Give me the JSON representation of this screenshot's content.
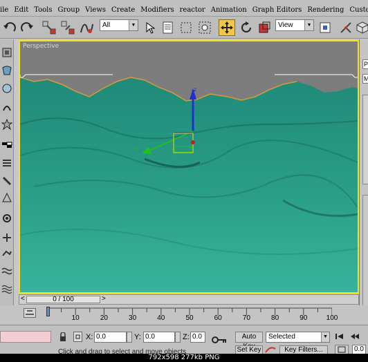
{
  "menu": [
    "ile",
    "Edit",
    "Tools",
    "Group",
    "Views",
    "Create",
    "Modifiers",
    "reactor",
    "Animation",
    "Graph Editors",
    "Rendering",
    "Customiz"
  ],
  "toolbar": {
    "selection_filter": "All",
    "ref_coord_system": "View"
  },
  "viewport": {
    "label": "Perspective",
    "gizmo_axes": [
      "z",
      "y"
    ]
  },
  "right_panel": {
    "boxes": [
      "P",
      "M"
    ]
  },
  "time_slider": {
    "value": "0 / 100",
    "prev": "<",
    "next": ">"
  },
  "trackbar": {
    "ticks": [
      "10",
      "20",
      "30",
      "40",
      "50",
      "60",
      "70",
      "80",
      "90",
      "100"
    ]
  },
  "status": {
    "x_label": "X:",
    "y_label": "Y:",
    "z_label": "Z:",
    "x_value": "0.0",
    "y_value": "0.0",
    "z_value": "0.0",
    "auto_key": "Auto Key",
    "set_key": "Set Key",
    "key_filters": "Key Filters...",
    "selected": "Selected",
    "prompt": "Click and drag to select and move objects"
  },
  "image_info": "792x598  277kb  PNG",
  "colors": {
    "terrain": "#2c9a86",
    "viewport_border": "#f3e51a",
    "active_tool": "#f2c64a"
  }
}
